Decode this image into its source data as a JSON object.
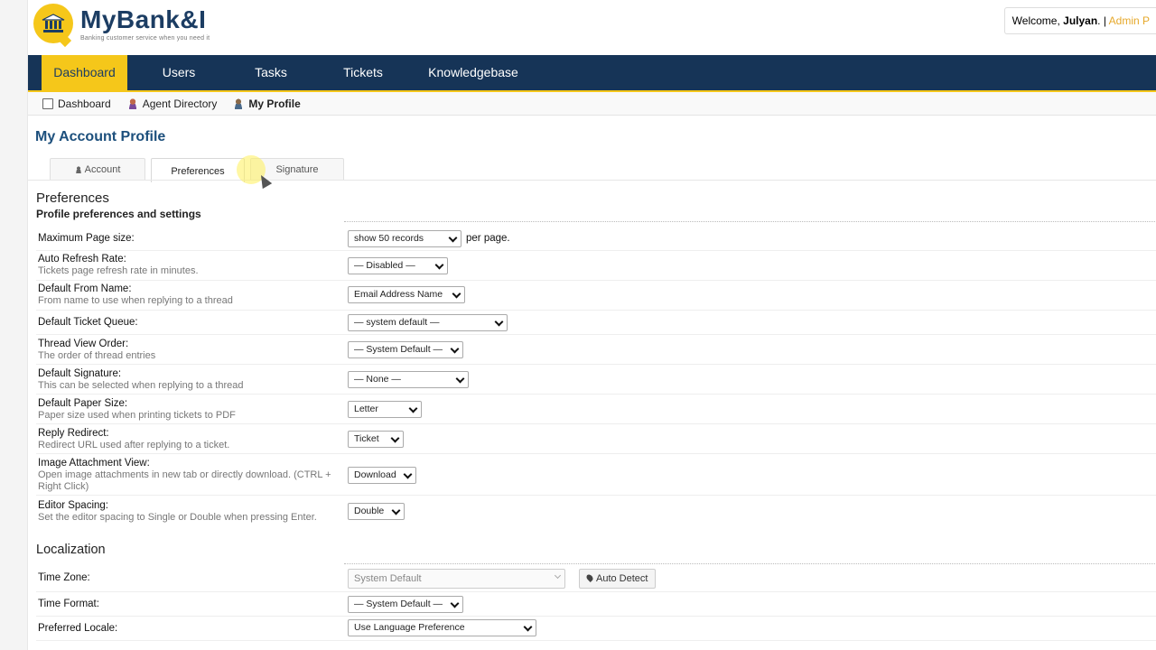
{
  "header": {
    "brand": "MyBank&I",
    "tagline": "Banking customer service when you need it",
    "welcome_prefix": "Welcome,",
    "user": "Julyan",
    "separator": ". |",
    "admin_link": "Admin P"
  },
  "nav": {
    "items": [
      {
        "label": "Dashboard",
        "active": true
      },
      {
        "label": "Users"
      },
      {
        "label": "Tasks"
      },
      {
        "label": "Tickets"
      },
      {
        "label": "Knowledgebase"
      }
    ]
  },
  "subnav": {
    "items": [
      {
        "label": "Dashboard"
      },
      {
        "label": "Agent Directory"
      },
      {
        "label": "My Profile",
        "current": true
      }
    ]
  },
  "page": {
    "title": "My Account Profile"
  },
  "tabs": [
    {
      "label": "Account"
    },
    {
      "label": "Preferences",
      "active": true
    },
    {
      "label": "Signature"
    }
  ],
  "preferences": {
    "title": "Preferences",
    "subtitle": "Profile preferences and settings",
    "rows": [
      {
        "label": "Maximum Page size:",
        "value": "show 50 records",
        "suffix": "per page."
      },
      {
        "label": "Auto Refresh Rate:",
        "desc": "Tickets page refresh rate in minutes.",
        "value": "— Disabled —"
      },
      {
        "label": "Default From Name:",
        "desc": "From name to use when replying to a thread",
        "value": "Email Address Name"
      },
      {
        "label": "Default Ticket Queue:",
        "value": "— system default —"
      },
      {
        "label": "Thread View Order:",
        "desc": "The order of thread entries",
        "value": "— System Default —"
      },
      {
        "label": "Default Signature:",
        "desc": "This can be selected when replying to a thread",
        "value": "— None —"
      },
      {
        "label": "Default Paper Size:",
        "desc": "Paper size used when printing tickets to PDF",
        "value": "Letter"
      },
      {
        "label": "Reply Redirect:",
        "desc": "Redirect URL used after replying to a ticket.",
        "value": "Ticket"
      },
      {
        "label": "Image Attachment View:",
        "desc": "Open image attachments in new tab or directly download. (CTRL + Right Click)",
        "value": "Download"
      },
      {
        "label": "Editor Spacing:",
        "desc": "Set the editor spacing to Single or Double when pressing Enter.",
        "value": "Double"
      }
    ]
  },
  "localization": {
    "title": "Localization",
    "rows": [
      {
        "label": "Time Zone:",
        "value": "System Default",
        "button": "Auto Detect"
      },
      {
        "label": "Time Format:",
        "value": "— System Default —"
      },
      {
        "label": "Preferred Locale:",
        "value": "Use Language Preference"
      }
    ]
  },
  "colors": {
    "navy": "#163457",
    "accent": "#f5c71a",
    "title_blue": "#1c4f7c"
  }
}
